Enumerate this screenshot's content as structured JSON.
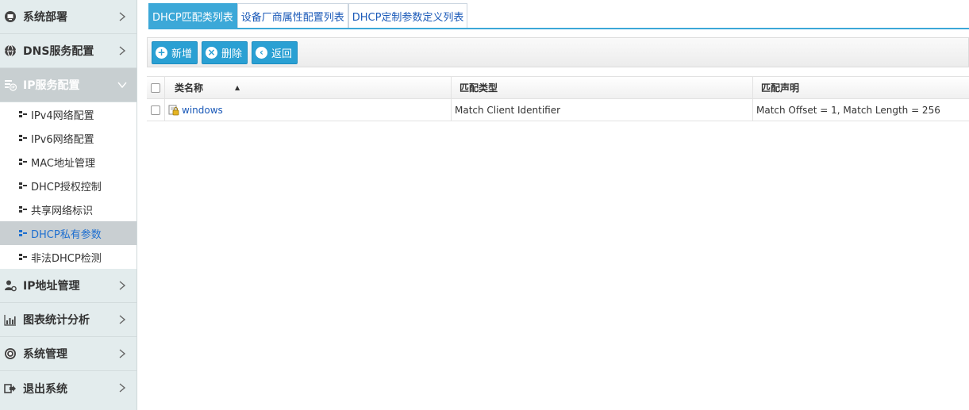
{
  "sidebar": {
    "sections_top": [
      {
        "label": "系统部署",
        "icon": "monitor-icon"
      },
      {
        "label": "DNS服务配置",
        "icon": "globe-icon"
      },
      {
        "label": "IP服务配置",
        "icon": "ip-config-icon"
      }
    ],
    "sub_items": [
      {
        "label": "IPv4网络配置"
      },
      {
        "label": "IPv6网络配置"
      },
      {
        "label": "MAC地址管理"
      },
      {
        "label": "DHCP授权控制"
      },
      {
        "label": "共享网络标识"
      },
      {
        "label": "DHCP私有参数"
      },
      {
        "label": "非法DHCP检测"
      }
    ],
    "sections_bottom": [
      {
        "label": "IP地址管理",
        "icon": "user-gear-icon"
      },
      {
        "label": "图表统计分析",
        "icon": "bar-chart-icon"
      },
      {
        "label": "系统管理",
        "icon": "settings-icon"
      },
      {
        "label": "退出系统",
        "icon": "logout-icon"
      }
    ]
  },
  "tabs": [
    {
      "label": "DHCP匹配类列表"
    },
    {
      "label": "设备厂商属性配置列表"
    },
    {
      "label": "DHCP定制参数定义列表"
    }
  ],
  "toolbar": {
    "add_label": "新增",
    "delete_label": "删除",
    "back_label": "返回"
  },
  "table": {
    "headers": {
      "name": "类名称",
      "type": "匹配类型",
      "declaration": "匹配声明"
    },
    "rows": [
      {
        "name": "windows",
        "type": "Match Client Identifier",
        "declaration": "Match Offset = 1, Match Length = 256"
      }
    ]
  },
  "colors": {
    "accent": "#2aa0d3",
    "sidebar_bg": "#e3eced",
    "active_link": "#1e6fd0"
  }
}
